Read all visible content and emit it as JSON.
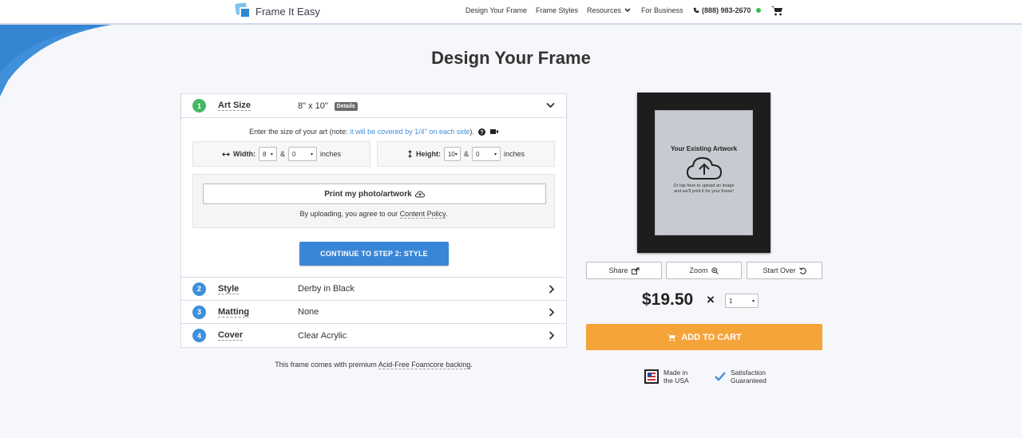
{
  "header": {
    "logo_text": "Frame It Easy",
    "nav": {
      "design": "Design Your Frame",
      "styles": "Frame Styles",
      "resources": "Resources",
      "business": "For Business",
      "phone": "(888) 983-2670"
    }
  },
  "page_title": "Design Your Frame",
  "steps": [
    {
      "num": "1",
      "name": "Art Size",
      "value": "8\" x 10\"",
      "badge": "Details"
    },
    {
      "num": "2",
      "name": "Style",
      "value": "Derby in Black"
    },
    {
      "num": "3",
      "name": "Matting",
      "value": "None"
    },
    {
      "num": "4",
      "name": "Cover",
      "value": "Clear Acrylic"
    }
  ],
  "size_form": {
    "note_prefix": "Enter the size of your art (note: ",
    "note_link": "it will be covered by 1/4\" on each side",
    "note_suffix": ").",
    "width_label": "Width:",
    "height_label": "Height:",
    "width_inches": "8",
    "width_fraction": "0",
    "height_inches": "10",
    "height_fraction": "0",
    "amp": "&",
    "unit": "inches"
  },
  "upload": {
    "button_label": "Print my photo/artwork",
    "note_prefix": "By uploading, you agree to our ",
    "policy_link": "Content Policy",
    "note_suffix": "."
  },
  "continue_label": "CONTINUE TO STEP 2: STYLE",
  "backing_note": {
    "prefix": "This frame comes with premium ",
    "link": "Acid-Free Foamcore backing",
    "suffix": "."
  },
  "preview": {
    "title": "Your Existing Artwork",
    "subtitle_line1": "Or tap here to upload an image",
    "subtitle_line2": "and we'll print it for your frame!"
  },
  "actions": {
    "share": "Share",
    "zoom": "Zoom",
    "start_over": "Start Over"
  },
  "price": "$19.50",
  "times": "×",
  "quantity": "1",
  "add_to_cart": "ADD TO CART",
  "badges": {
    "usa_line1": "Made in",
    "usa_line2": "the USA",
    "sat_line1": "Satisfaction",
    "sat_line2": "Guaranteed"
  },
  "colors": {
    "accent_blue": "#3a86d6",
    "cart_orange": "#f5a43a",
    "step_green": "#43b863",
    "online_green": "#2fbf4e"
  }
}
